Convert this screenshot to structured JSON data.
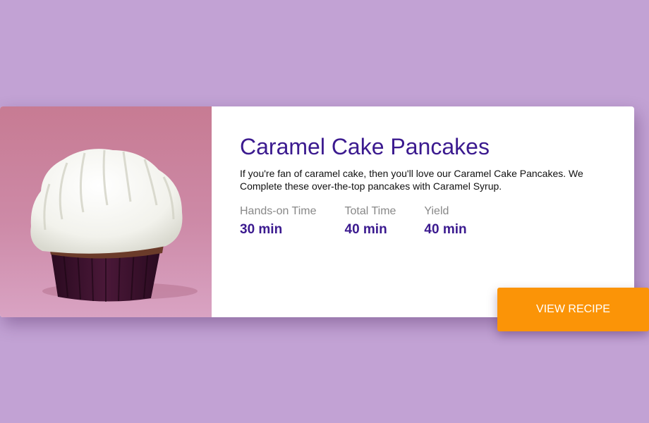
{
  "recipe": {
    "title": "Caramel Cake Pancakes",
    "description": "If you're fan of caramel cake, then you'll love our Caramel Cake Pancakes. We Complete these over-the-top pancakes with Caramel Syrup.",
    "image_subject": "cupcake-with-white-frosting",
    "stats": [
      {
        "label": "Hands-on Time",
        "value": "30 min"
      },
      {
        "label": "Total Time",
        "value": "40 min"
      },
      {
        "label": "Yield",
        "value": "40 min"
      }
    ],
    "button_label": "VIEW RECIPE"
  },
  "colors": {
    "background": "#c2a2d4",
    "card": "#ffffff",
    "accent": "#3b1a8f",
    "button": "#fb9407",
    "muted_text": "#888888"
  }
}
